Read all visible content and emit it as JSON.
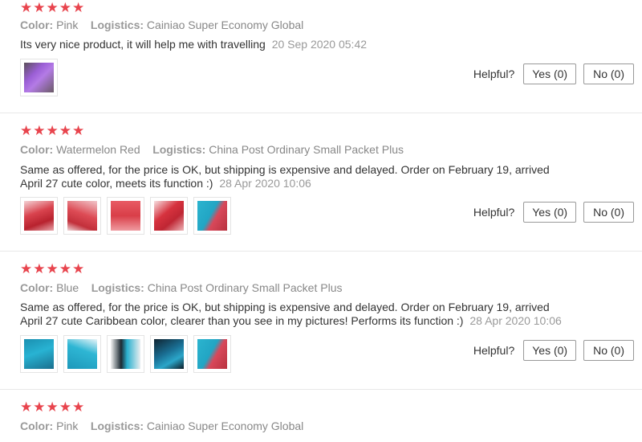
{
  "reviews": [
    {
      "stars": "★★★★★",
      "color_label": "Color:",
      "color_value": "Pink",
      "logistics_label": "Logistics:",
      "logistics_value": "Cainiao Super Economy Global",
      "text": "Its very nice product, it will help me with travelling",
      "date": "20 Sep 2020 05:42",
      "photos": [
        "purple"
      ],
      "helpful_label": "Helpful?",
      "yes_label": "Yes (0)",
      "no_label": "No (0)"
    },
    {
      "stars": "★★★★★",
      "color_label": "Color:",
      "color_value": "Watermelon Red",
      "logistics_label": "Logistics:",
      "logistics_value": "China Post Ordinary Small Packet Plus",
      "text": "Same as offered, for the price is OK, but shipping is expensive and delayed. Order on February 19, arrived April 27 cute color, meets its function :)",
      "date": "28 Apr 2020 10:06",
      "photos": [
        "red",
        "red",
        "red",
        "red",
        "mixed"
      ],
      "helpful_label": "Helpful?",
      "yes_label": "Yes (0)",
      "no_label": "No (0)"
    },
    {
      "stars": "★★★★★",
      "color_label": "Color:",
      "color_value": "Blue",
      "logistics_label": "Logistics:",
      "logistics_value": "China Post Ordinary Small Packet Plus",
      "text": "Same as offered, for the price is OK, but shipping is expensive and delayed. Order on February 19, arrived April 27 cute Caribbean color, clearer than you see in my pictures! Performs its function :)",
      "date": "28 Apr 2020 10:06",
      "photos": [
        "blue",
        "blue",
        "dark",
        "navy",
        "mixed"
      ],
      "helpful_label": "Helpful?",
      "yes_label": "Yes (0)",
      "no_label": "No (0)"
    },
    {
      "stars": "★★★★★",
      "color_label": "Color:",
      "color_value": "Pink",
      "logistics_label": "Logistics:",
      "logistics_value": "Cainiao Super Economy Global"
    }
  ],
  "colors": {
    "star": "#e8444d",
    "border": "#e8e8e8"
  }
}
